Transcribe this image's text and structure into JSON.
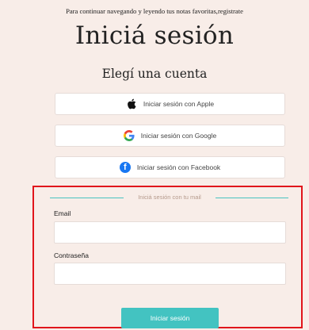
{
  "header": {
    "note": "Para continuar navegando y leyendo tus notas favoritas,registrate",
    "title": "Iniciá sesión",
    "subtitle": "Elegí una cuenta"
  },
  "social_buttons": [
    {
      "label": "Iniciar sesión con Apple",
      "icon": "apple-icon"
    },
    {
      "label": "Iniciar sesión con Google",
      "icon": "google-icon"
    },
    {
      "label": "Iniciar sesión con Facebook",
      "icon": "facebook-icon"
    }
  ],
  "mail_form": {
    "divider_text": "Iniciá sesión con tu mail",
    "email_label": "Email",
    "email_value": "",
    "password_label": "Contraseña",
    "password_value": "",
    "submit_label": "Iniciar sesión"
  },
  "colors": {
    "background": "#f8ede8",
    "accent": "#43c3c1",
    "highlight_border": "#e0151b",
    "facebook": "#1877f2"
  }
}
